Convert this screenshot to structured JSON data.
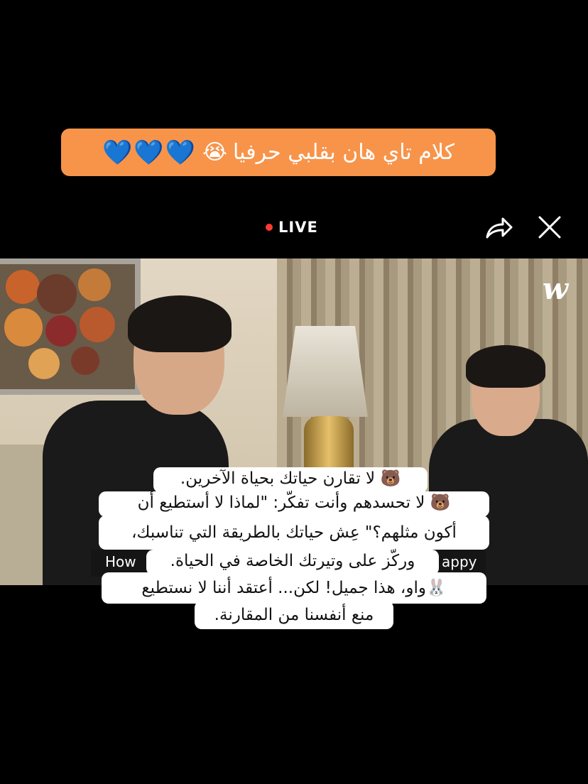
{
  "banner": {
    "text": "كلام تاي هان بقلبي حرفيا",
    "cry_emoji": "😭",
    "hearts": "💙💙💙"
  },
  "header": {
    "live_label": "LIVE",
    "share_icon": "share-icon",
    "close_icon": "close-icon"
  },
  "video": {
    "logo": "w",
    "caption_left": "How",
    "caption_right": "appy"
  },
  "subtitles": [
    "🐻 لا تقارن حياتك بحياة الآخرين.",
    "🐻 لا تحسدهم وأنت تفكّر: \"لماذا لا أستطيع أن",
    "أكون مثلهم؟\" عِش حياتك بالطريقة التي تناسبك،",
    "وركّز على وتيرتك الخاصة في الحياة.",
    "🐰واو، هذا جميل! لكن... أعتقد أننا لا نستطيع",
    "منع أنفسنا من المقارنة."
  ],
  "colors": {
    "banner_bg": "#f7944a",
    "live_dot": "#ff3b2f",
    "background": "#000000"
  }
}
